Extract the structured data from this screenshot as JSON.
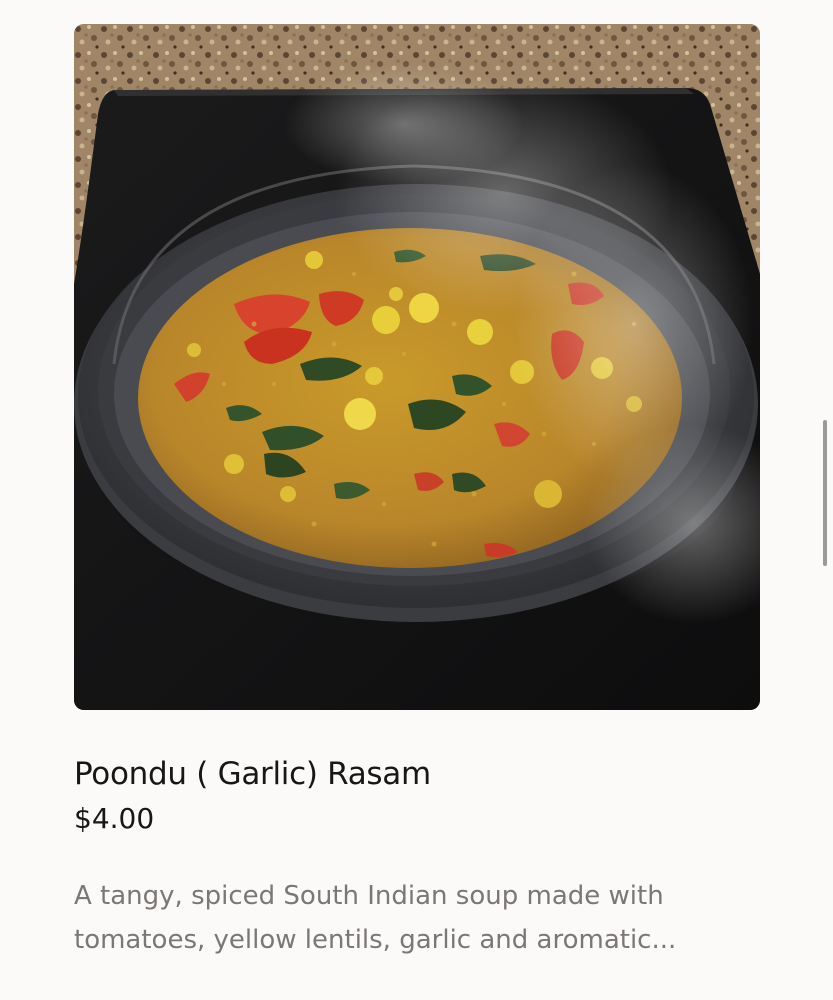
{
  "product": {
    "image_alt": "Poondu ( Garlic) Rasam in a dark pan on a cooktop",
    "name": "Poondu ( Garlic) Rasam",
    "price": "$4.00",
    "description_line1": "A tangy, spiced South Indian soup made with",
    "description_line2": "tomatoes, yellow lentils, garlic and aromatic..."
  },
  "colors": {
    "page_background": "#fbfaf9",
    "title_text": "#171717",
    "description_text": "#7b7775",
    "scrollbar": "#9a9a9a"
  }
}
